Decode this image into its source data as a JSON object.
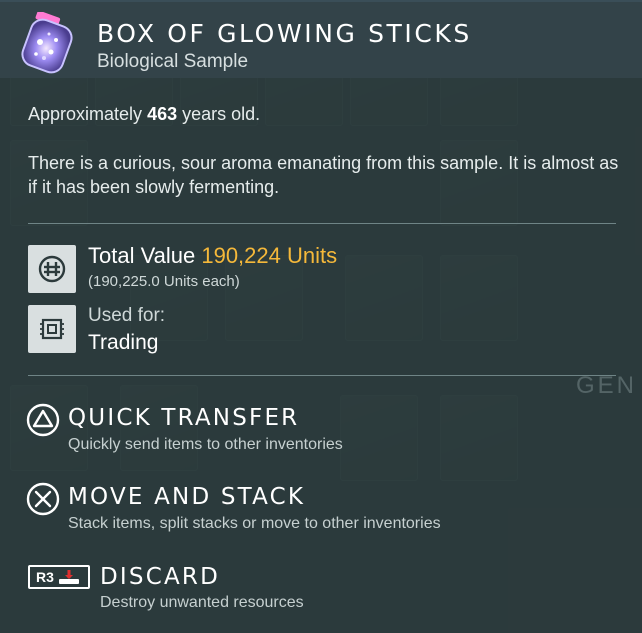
{
  "item": {
    "title": "BOX OF GLOWING STICKS",
    "subtitle": "Biological Sample",
    "icon": "glowing-jar-icon"
  },
  "age": {
    "prefix": "Approximately ",
    "years": "463",
    "suffix": " years old."
  },
  "description": "There is a curious, sour aroma emanating from this sample. It is almost as if it has been slowly fermenting.",
  "value": {
    "label": "Total Value ",
    "units": "190,224 Units",
    "each": "(190,225.0 Units each)",
    "icon": "units-currency-icon"
  },
  "used_for": {
    "label": "Used for:",
    "value": "Trading",
    "icon": "trade-chip-icon"
  },
  "actions": [
    {
      "title": "QUICK TRANSFER",
      "description": "Quickly send items to other inventories",
      "button": "triangle-button-icon"
    },
    {
      "title": "MOVE AND STACK",
      "description": "Stack items, split stacks or move to other inventories",
      "button": "cross-button-icon"
    },
    {
      "title": "DISCARD",
      "description": "Destroy unwanted resources",
      "button": "r3-button-icon",
      "button_label": "R3"
    }
  ],
  "colors": {
    "accent": "#f5b83a",
    "panel": "#2c3a3c",
    "header": "#34444a"
  }
}
